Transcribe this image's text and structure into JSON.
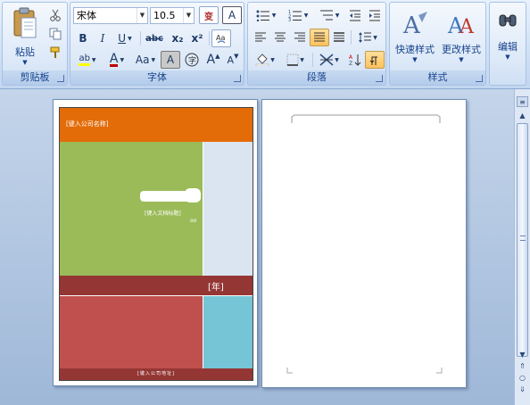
{
  "clipboard": {
    "paste_label": "粘贴",
    "group_label": "剪贴板"
  },
  "font": {
    "name": "宋体",
    "size": "10.5",
    "group_label": "字体",
    "bold": "B",
    "italic": "I",
    "underline": "U",
    "strike": "abc",
    "sub": "x₂",
    "sup": "x²",
    "color_letter": "A",
    "case": "Aa",
    "grow": "A",
    "shrink": "A"
  },
  "paragraph": {
    "group_label": "段落"
  },
  "styles": {
    "quick_label": "快速样式",
    "change_label": "更改样式",
    "group_label": "样式"
  },
  "editing": {
    "label": "编辑"
  },
  "cover": {
    "company_name": "[键入公司名称]",
    "doc_title": "[键入文档标题]",
    "year": "[年]",
    "company_address": "[键入公司地址]"
  },
  "colors": {
    "orange": "#e36c09",
    "green": "#9bbb59",
    "pale_blue": "#dbe5f1",
    "dark_red": "#943634",
    "red": "#c0504d",
    "teal": "#76c5d6",
    "ribbon_text": "#15428b"
  }
}
